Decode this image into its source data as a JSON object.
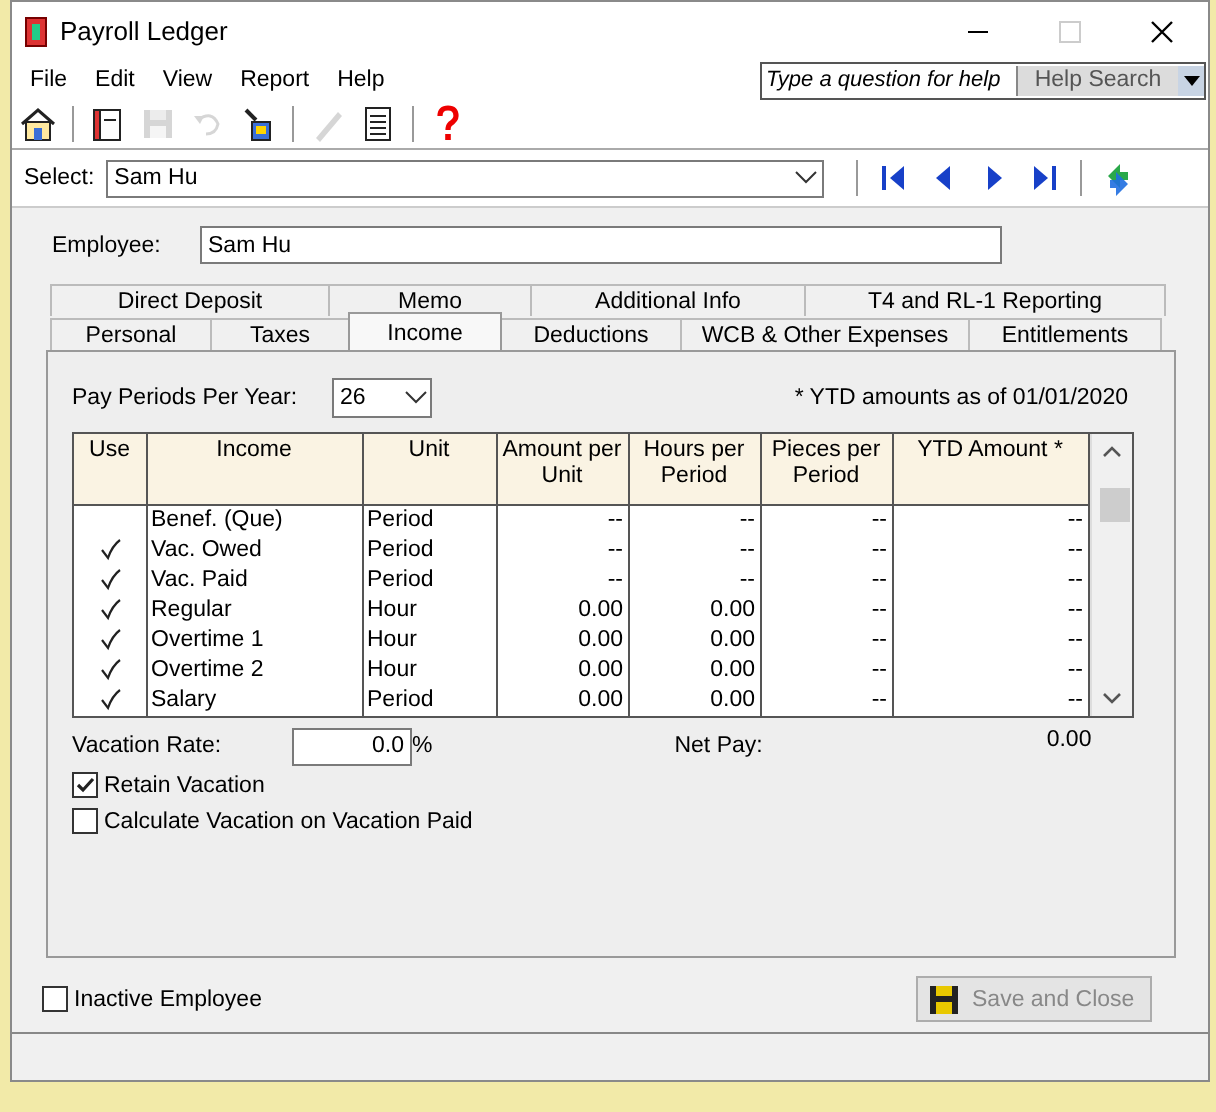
{
  "window": {
    "title": "Payroll Ledger",
    "maximize_disabled": true
  },
  "menu": [
    "File",
    "Edit",
    "View",
    "Report",
    "Help"
  ],
  "help_search": {
    "placeholder": "Type a question for help",
    "button": "Help Search"
  },
  "toolbar": [
    {
      "kind": "home",
      "disabled": false
    },
    {
      "kind": "sep"
    },
    {
      "kind": "ledger",
      "disabled": false
    },
    {
      "kind": "save",
      "disabled": true
    },
    {
      "kind": "undo",
      "disabled": true
    },
    {
      "kind": "bucket",
      "disabled": false
    },
    {
      "kind": "sep"
    },
    {
      "kind": "pencil",
      "disabled": true
    },
    {
      "kind": "list",
      "disabled": false
    },
    {
      "kind": "sep"
    },
    {
      "kind": "help",
      "disabled": false
    }
  ],
  "select": {
    "label": "Select:",
    "value": "Sam Hu"
  },
  "navigation": [
    {
      "kind": "first"
    },
    {
      "kind": "prev"
    },
    {
      "kind": "next"
    },
    {
      "kind": "last"
    },
    {
      "kind": "sep"
    },
    {
      "kind": "swap"
    }
  ],
  "employee": {
    "label": "Employee:",
    "value": "Sam Hu"
  },
  "tab_rows": [
    [
      {
        "label": "Direct Deposit",
        "selected": false
      },
      {
        "label": "Memo",
        "selected": false
      },
      {
        "label": "Additional Info",
        "selected": false
      },
      {
        "label": "T4 and RL-1 Reporting",
        "selected": false
      }
    ],
    [
      {
        "label": "Personal",
        "selected": false
      },
      {
        "label": "Taxes",
        "selected": false
      },
      {
        "label": "Income",
        "selected": true
      },
      {
        "label": "Deductions",
        "selected": false
      },
      {
        "label": "WCB & Other Expenses",
        "selected": false
      },
      {
        "label": "Entitlements",
        "selected": false
      }
    ]
  ],
  "pay_periods": {
    "label": "Pay Periods Per Year:",
    "value": "26"
  },
  "ytd_note": "* YTD amounts as of 01/01/2020",
  "table": {
    "use_column": "Use",
    "columns": [
      "Income",
      "Unit",
      "Amount per Unit",
      "Hours per Period",
      "Pieces per Period",
      "YTD Amount *"
    ],
    "rows": [
      {
        "checked": false,
        "cells": [
          "Benef. (Que)",
          "Period",
          "--",
          "--",
          "--",
          "--"
        ]
      },
      {
        "checked": true,
        "cells": [
          "Vac. Owed",
          "Period",
          "--",
          "--",
          "--",
          "--"
        ]
      },
      {
        "checked": true,
        "cells": [
          "Vac. Paid",
          "Period",
          "--",
          "--",
          "--",
          "--"
        ]
      },
      {
        "checked": true,
        "cells": [
          "Regular",
          "Hour",
          "0.00",
          "0.00",
          "--",
          "--"
        ]
      },
      {
        "checked": true,
        "cells": [
          "Overtime 1",
          "Hour",
          "0.00",
          "0.00",
          "--",
          "--"
        ]
      },
      {
        "checked": true,
        "cells": [
          "Overtime 2",
          "Hour",
          "0.00",
          "0.00",
          "--",
          "--"
        ]
      },
      {
        "checked": true,
        "cells": [
          "Salary",
          "Period",
          "0.00",
          "0.00",
          "--",
          "--"
        ]
      }
    ]
  },
  "vacation_rate": {
    "label": "Vacation Rate:",
    "value": "0.0",
    "unit": "%"
  },
  "net_pay": {
    "label": "Net Pay:",
    "value": "0.00"
  },
  "options": [
    {
      "label": "Retain Vacation",
      "checked": true
    },
    {
      "label": "Calculate Vacation on Vacation Paid",
      "checked": false
    }
  ],
  "inactive": {
    "label": "Inactive Employee",
    "checked": false
  },
  "save_button": {
    "label": "Save and Close",
    "disabled": true
  }
}
